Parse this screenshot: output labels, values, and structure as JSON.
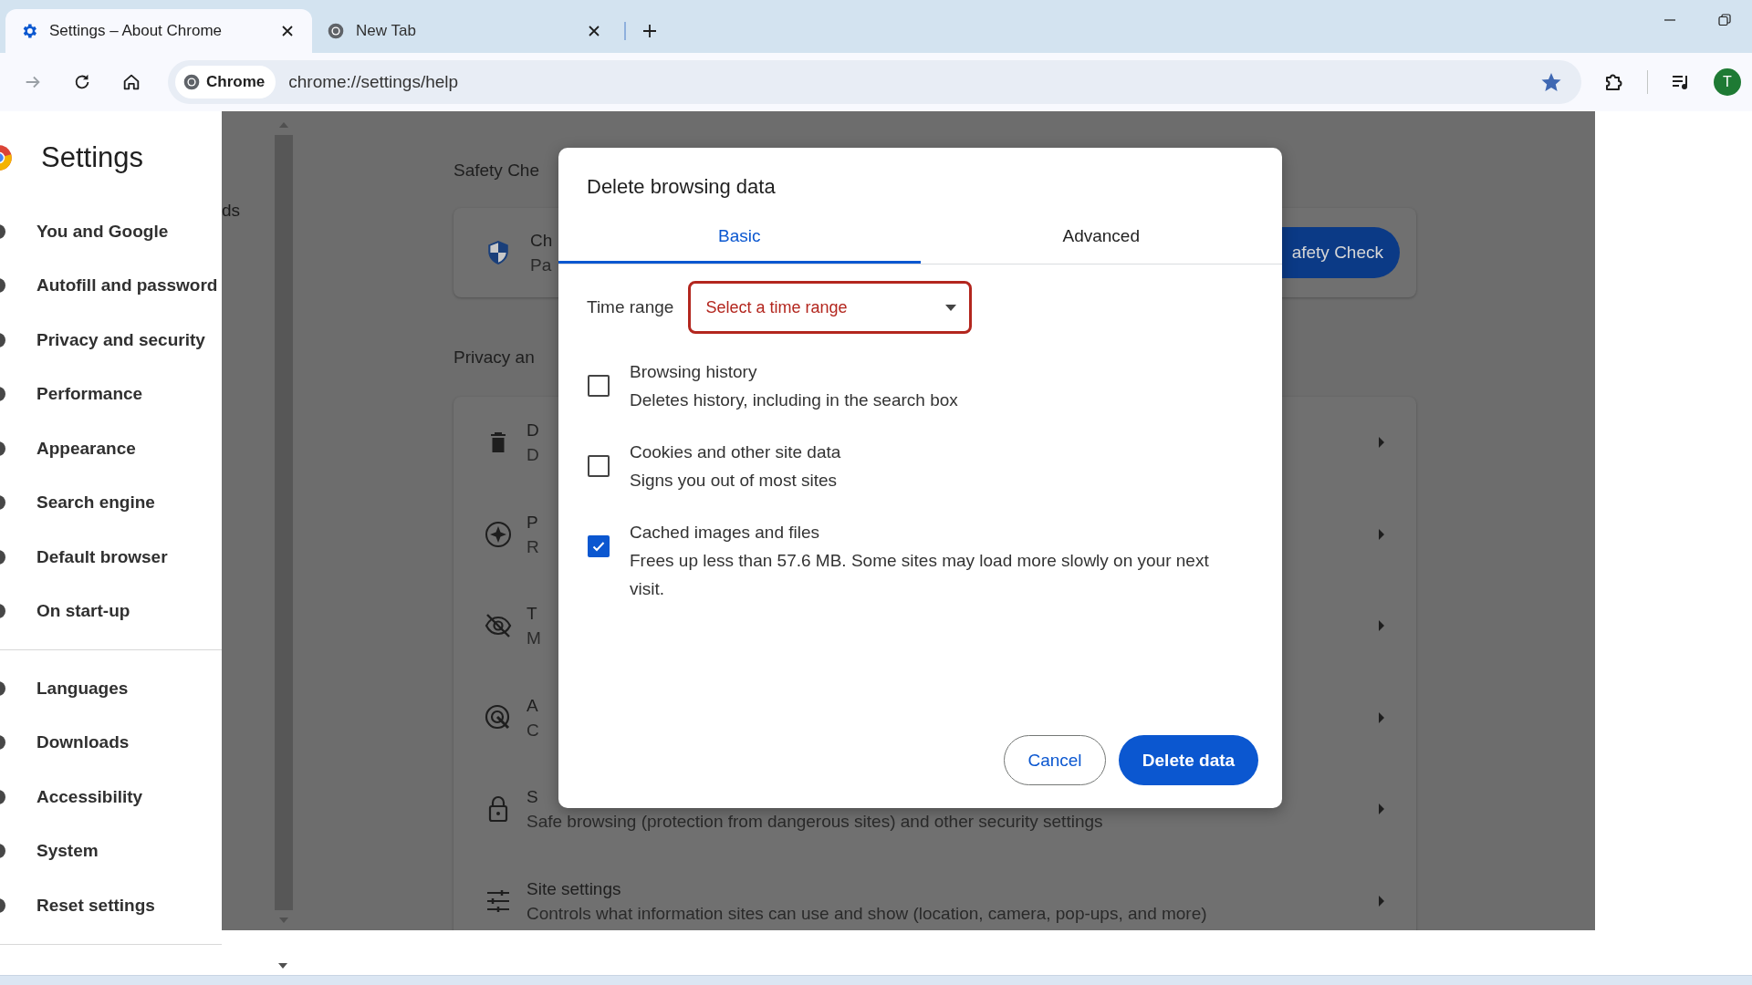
{
  "browser_tabs": [
    {
      "kind": "settings",
      "title": "Settings – About Chrome",
      "selected": true
    },
    {
      "kind": "chrome",
      "title": "New Tab",
      "selected": false
    }
  ],
  "toolbar": {
    "chip": "Chrome",
    "url": "chrome://settings/help",
    "bookmarked": true,
    "avatar": "T"
  },
  "sidebar": {
    "title": "Settings",
    "sections": [
      {
        "items": [
          "You and Google",
          "Autofill and password",
          "Privacy and security",
          "Performance",
          "Appearance",
          "Search engine",
          "Default browser",
          "On start-up"
        ]
      },
      {
        "items": [
          "Languages",
          "Downloads",
          "Accessibility",
          "System",
          "Reset settings"
        ]
      }
    ]
  },
  "page": {
    "fragment": "ds",
    "safety_heading": "Safety Che",
    "safety_card": {
      "line_1": "Ch",
      "line_2": "Pa",
      "button": "afety Check"
    },
    "privacy_heading": "Privacy an",
    "privacy_rows": [
      {
        "kind": "trash",
        "line_1": "D",
        "line_2": "D"
      },
      {
        "kind": "compass",
        "line_1": "P",
        "line_2": "R"
      },
      {
        "kind": "eye-off",
        "line_1": "T",
        "line_2": "M"
      },
      {
        "kind": "target",
        "line_1": "A",
        "line_2": "C"
      },
      {
        "kind": "lock",
        "line_1": "S",
        "line_2": "Safe browsing (protection from dangerous sites) and other security settings"
      },
      {
        "kind": "sliders",
        "line_1": "Site settings",
        "line_2": "Controls what information sites can use and show (location, camera, pop-ups, and more)"
      }
    ]
  },
  "dialog": {
    "title": "Delete browsing data",
    "tabs": [
      {
        "label": "Basic",
        "selected": true
      },
      {
        "label": "Advanced",
        "selected": false
      }
    ],
    "time_range": {
      "label": "Time range",
      "placeholder": "Select a time range",
      "invalid": true
    },
    "options": [
      {
        "title": "Browsing history",
        "description": "Deletes history, including in the search box",
        "checked": false
      },
      {
        "title": "Cookies and other site data",
        "description": "Signs you out of most sites",
        "checked": false
      },
      {
        "title": "Cached images and files",
        "description": "Frees up less than 57.6 MB. Some sites may load more slowly on your next visit.",
        "checked": true
      }
    ],
    "buttons": [
      {
        "label": "Cancel",
        "kind": "secondary"
      },
      {
        "label": "Delete data",
        "kind": "primary"
      }
    ]
  }
}
